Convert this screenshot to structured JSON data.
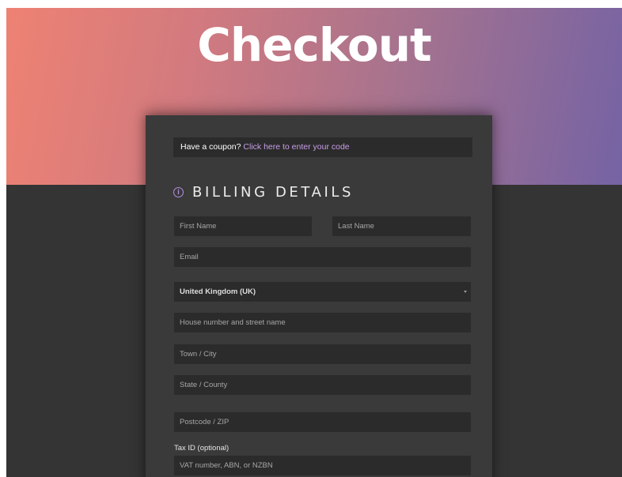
{
  "page": {
    "title": "Checkout"
  },
  "coupon": {
    "question": "Have a coupon?",
    "link": "Click here to enter your code"
  },
  "billing": {
    "heading": "BILLING DETAILS",
    "icon": "info-circle-icon",
    "first_name_placeholder": "First Name",
    "last_name_placeholder": "Last Name",
    "email_placeholder": "Email",
    "country_value": "United Kingdom (UK)",
    "street_placeholder": "House number and street name",
    "city_placeholder": "Town / City",
    "state_placeholder": "State / County",
    "postcode_placeholder": "Postcode / ZIP",
    "tax_label": "Tax ID (optional)",
    "tax_placeholder": "VAT number, ABN, or NZBN"
  },
  "colors": {
    "hero_gradient_start": "#ee8273",
    "hero_gradient_end": "#7563a4",
    "background": "#343434",
    "card": "#3a3a3a",
    "field": "#2b2b2b",
    "accent": "#c99ee8"
  }
}
